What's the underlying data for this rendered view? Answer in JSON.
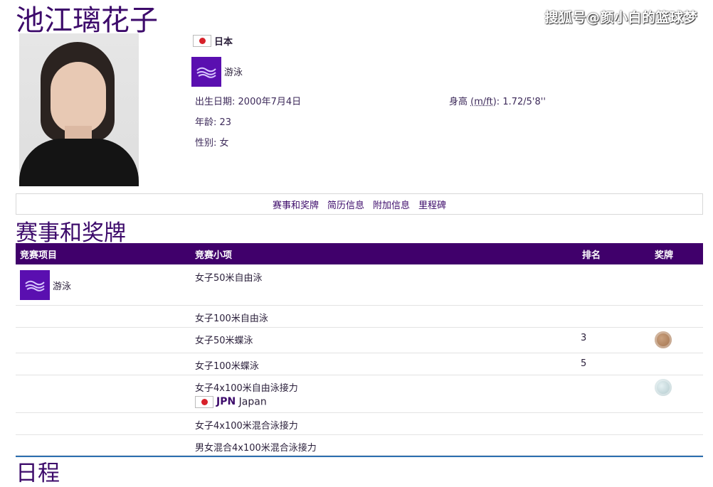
{
  "watermark": "搜狐号@颜小白的篮球梦",
  "athlete": {
    "name": "池江璃花子",
    "country": "日本",
    "sport": "游泳",
    "birth_label": "出生日期",
    "birth_value": "2000年7月4日",
    "height_label": "身高",
    "height_unit": "(m/ft)",
    "height_value": "1.72/5'8''",
    "age_label": "年龄",
    "age_value": "23",
    "gender_label": "性别",
    "gender_value": "女"
  },
  "nav": [
    "赛事和奖牌",
    "简历信息",
    "附加信息",
    "里程碑"
  ],
  "section_title": "赛事和奖牌",
  "table": {
    "headers": [
      "竞赛项目",
      "竞赛小项",
      "排名",
      "奖牌"
    ],
    "sport": "游泳",
    "rows": [
      {
        "event": "女子50米自由泳",
        "rank": "",
        "medal": ""
      },
      {
        "event": "女子100米自由泳",
        "rank": "",
        "medal": ""
      },
      {
        "event": "女子50米蝶泳",
        "rank": "3",
        "medal": "bronze"
      },
      {
        "event": "女子100米蝶泳",
        "rank": "5",
        "medal": ""
      },
      {
        "event": "女子4x100米自由泳接力",
        "rank": "",
        "medal": "silver",
        "team_code": "JPN",
        "team_name": "Japan"
      },
      {
        "event": "女子4x100米混合泳接力",
        "rank": "",
        "medal": ""
      },
      {
        "event": "男女混合4x100米混合泳接力",
        "rank": "",
        "medal": ""
      }
    ]
  },
  "next_section_title": "日程"
}
